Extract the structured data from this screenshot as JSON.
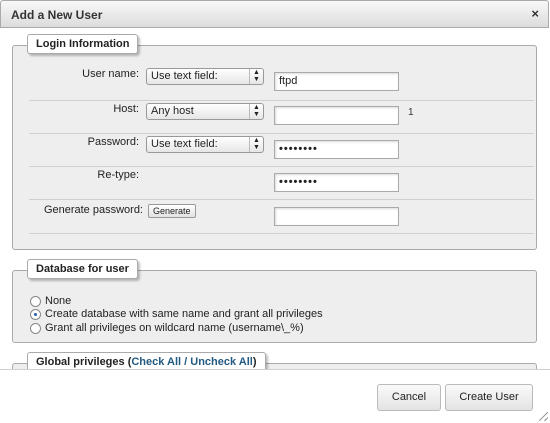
{
  "dialog": {
    "title": "Add a New User",
    "close_glyph": "×"
  },
  "login": {
    "legend": "Login Information",
    "username": {
      "label": "User name:",
      "select": "Use text field:",
      "value": "ftpd"
    },
    "host": {
      "label": "Host:",
      "select": "Any host",
      "value": "",
      "hint": "1"
    },
    "password": {
      "label": "Password:",
      "select": "Use text field:",
      "value": "••••••••"
    },
    "retype": {
      "label": "Re-type:",
      "value": "••••••••"
    },
    "generate": {
      "label": "Generate password:",
      "button": "Generate",
      "value": ""
    }
  },
  "database": {
    "legend": "Database for user",
    "options": [
      {
        "label": "None",
        "checked": false
      },
      {
        "label": "Create database with same name and grant all privileges",
        "checked": true
      },
      {
        "label": "Grant all privileges on wildcard name (username\\_%)",
        "checked": false
      }
    ]
  },
  "privileges": {
    "legend_prefix": "Global privileges (",
    "check_all": "Check All",
    "sep": " / ",
    "uncheck_all": "Uncheck All",
    "legend_suffix": ")"
  },
  "footer": {
    "cancel": "Cancel",
    "create": "Create User"
  },
  "icons": {
    "select_arrows": "▲▼"
  }
}
